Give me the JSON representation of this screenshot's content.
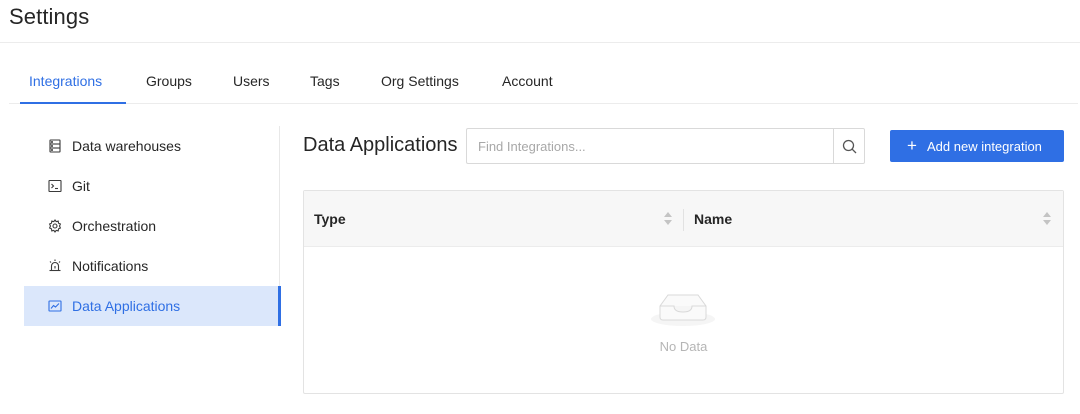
{
  "page": {
    "title": "Settings"
  },
  "tabs": [
    {
      "label": "Integrations",
      "active": true
    },
    {
      "label": "Groups"
    },
    {
      "label": "Users"
    },
    {
      "label": "Tags"
    },
    {
      "label": "Org Settings"
    },
    {
      "label": "Account"
    }
  ],
  "sidebar": {
    "items": [
      {
        "label": "Data warehouses",
        "icon": "database-icon"
      },
      {
        "label": "Git",
        "icon": "terminal-icon"
      },
      {
        "label": "Orchestration",
        "icon": "gear-icon"
      },
      {
        "label": "Notifications",
        "icon": "alarm-icon"
      },
      {
        "label": "Data Applications",
        "icon": "line-chart-icon",
        "active": true
      }
    ]
  },
  "main": {
    "title": "Data Applications",
    "search": {
      "placeholder": "Find Integrations...",
      "value": ""
    },
    "add_button": {
      "label": "Add new integration"
    },
    "table": {
      "columns": [
        {
          "label": "Type"
        },
        {
          "label": "Name"
        }
      ],
      "rows": [],
      "empty_text": "No Data"
    }
  },
  "colors": {
    "accent": "#2f6fe4",
    "active_background": "#dbe7fb",
    "text": "#262626",
    "muted": "#b5b5b5"
  }
}
